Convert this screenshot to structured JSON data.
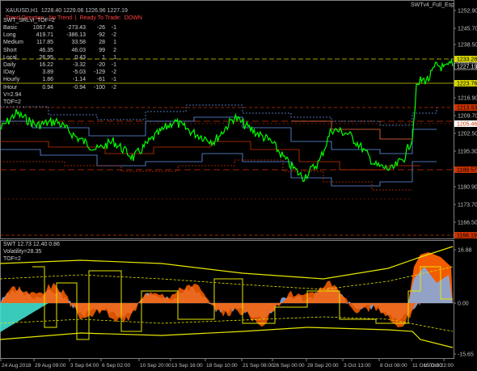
{
  "main_header": {
    "symbol": "XAUUSD,H1",
    "ohlc": "1228.40 1229.06 1226.96 1227.19",
    "trend_label": "Trend Direction:  No Trend",
    "ready_label": "Ready To Trade:  DOWN",
    "indicator_name": "SWTv4_Full_Esp"
  },
  "stats_panel": {
    "title": "SWT_SRLvl_TOF=2",
    "rows": [
      {
        "name": "Basic",
        "v1": "1067.45",
        "v2": "-273.43",
        "v3": "-26",
        "v4": "-1"
      },
      {
        "name": "Long",
        "v1": "419.71",
        "v2": "-386.13",
        "v3": "-92",
        "v4": "-2"
      },
      {
        "name": "Medium",
        "v1": "117.85",
        "v2": "33.58",
        "v3": "28",
        "v4": "1"
      },
      {
        "name": "Short",
        "v1": "46.35",
        "v2": "46.03",
        "v3": "99",
        "v4": "2"
      },
      {
        "name": "Local",
        "v1": "26.95",
        "v2": "0.43",
        "v3": "1",
        "v4": "1"
      },
      {
        "name": "Daily",
        "v1": "16.22",
        "v2": "-3.32",
        "v3": "-20",
        "v4": "-1"
      },
      {
        "name": "IDay",
        "v1": "3.89",
        "v2": "-5.03",
        "v3": "-129",
        "v4": "-2"
      },
      {
        "name": "Hourly",
        "v1": "1.86",
        "v2": "-1.14",
        "v3": "-61",
        "v4": "-1"
      },
      {
        "name": "IHour",
        "v1": "0.94",
        "v2": "-0.94",
        "v3": "-100",
        "v4": "-2"
      }
    ],
    "v_line": "V=2.94",
    "tof_line": "TOF=2"
  },
  "price_axis": {
    "ticks": [
      "1252.90",
      "1245.70",
      "1238.50",
      "1231.30",
      "1223.70",
      "1216.90",
      "1209.70",
      "1202.50",
      "1195.30",
      "1188.10",
      "1180.90",
      "1173.70",
      "1166.50"
    ],
    "highlight_labels": [
      {
        "text": "1233.28",
        "color": "#d7d700",
        "text_color": "#000000"
      },
      {
        "text": "1227.19",
        "color": "#000000",
        "text_color": "#ffffff"
      },
      {
        "text": "1223.76",
        "color": "#d7d700",
        "text_color": "#000000"
      },
      {
        "text": "1213.53",
        "color": "#cc3300",
        "text_color": "#000000"
      },
      {
        "text": "1205.46",
        "color": "#ffffff",
        "text_color": "#cc3300"
      },
      {
        "text": "1189.57",
        "color": "#cc3300",
        "text_color": "#000000"
      },
      {
        "text": "1166.19",
        "color": "#cc3300",
        "text_color": "#000000"
      }
    ]
  },
  "osc_header": {
    "line1": "SWT 12.73 12.40 0.86",
    "line2": "Volatility=28.35",
    "line3": "TOF=2"
  },
  "osc_axis": {
    "ticks": [
      "16.88",
      "0.00",
      "-15.65"
    ]
  },
  "time_axis": {
    "labels": [
      "24 Aug 2018",
      "29 Aug 09:00",
      "3 Sep 04:00",
      "6 Sep 02:00",
      "10 Sep 20:00",
      "13 Sep 16:00",
      "18 Sep 10:00",
      "21 Sep 08:00",
      "26 Sep 00:00",
      "28 Sep 20:00",
      "3 Oct 13:00",
      "8 Oct 08:00",
      "11 Oct 03:00",
      "15 Oct 22:00"
    ]
  },
  "colors": {
    "price": "#00ff00",
    "blue_band": "#6495ed",
    "red_band": "#cc3300",
    "yellow": "#e6e600",
    "osc_fill": "#ff6000",
    "osc_blue": "#87aadd",
    "osc_cyan": "#40e0d0"
  }
}
